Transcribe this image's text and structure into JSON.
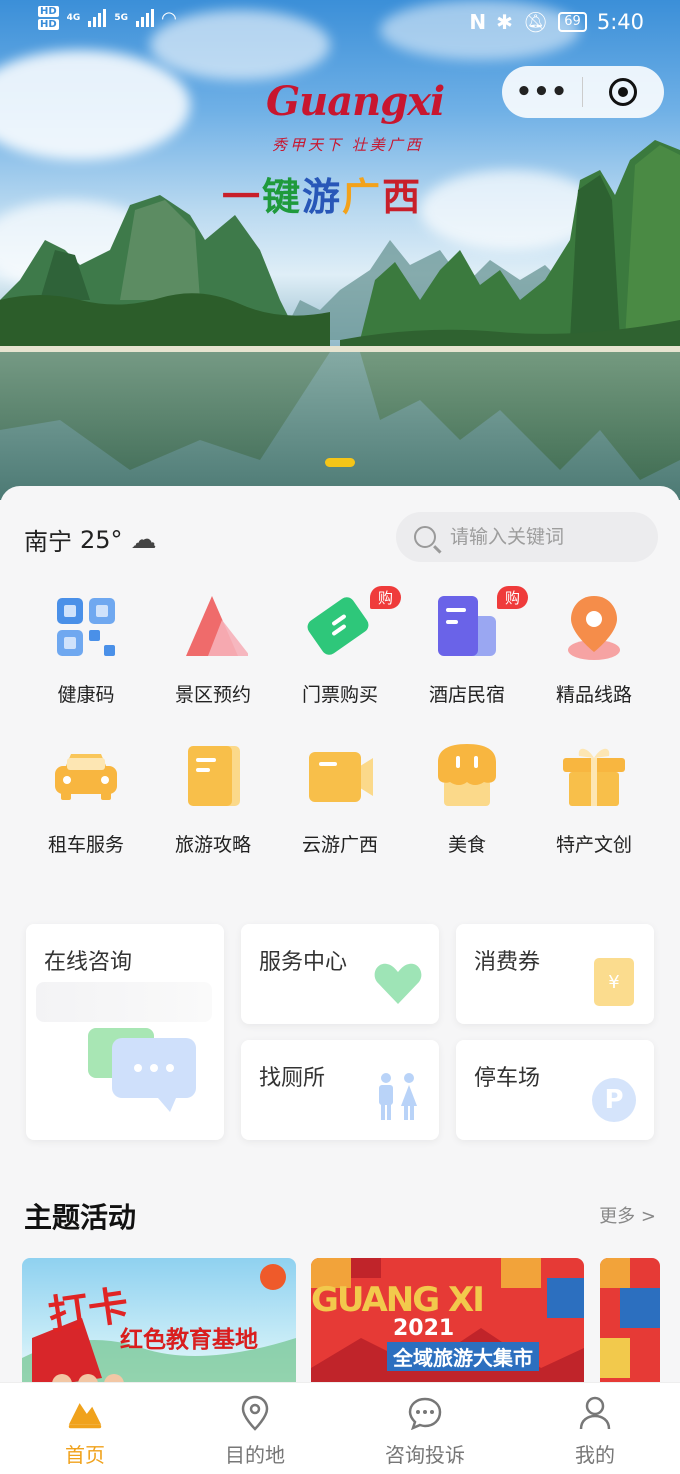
{
  "status_bar": {
    "left_tags": [
      "HD",
      "HD"
    ],
    "network_1": "4G",
    "network_2": "5G",
    "battery": "69",
    "time": "5:40"
  },
  "capsule": {
    "more_label": "•••",
    "close_icon": "target-icon"
  },
  "hero": {
    "logo_text": "Guangxi",
    "logo_tagline": "秀甲天下 壮美广西",
    "slogan_parts": [
      "一",
      "键",
      "游",
      "广",
      "西"
    ]
  },
  "weather": {
    "city": "南宁",
    "temperature": "25°",
    "icon": "partly-cloudy-icon"
  },
  "search": {
    "placeholder": "请输入关键词"
  },
  "services": [
    {
      "label": "健康码",
      "icon": "qr-code-icon"
    },
    {
      "label": "景区预约",
      "icon": "mountain-icon"
    },
    {
      "label": "门票购买",
      "icon": "ticket-icon",
      "badge": "购"
    },
    {
      "label": "酒店民宿",
      "icon": "hotel-icon",
      "badge": "购"
    },
    {
      "label": "精品线路",
      "icon": "location-pin-icon"
    },
    {
      "label": "租车服务",
      "icon": "car-icon"
    },
    {
      "label": "旅游攻略",
      "icon": "guide-book-icon"
    },
    {
      "label": "云游广西",
      "icon": "video-camera-icon"
    },
    {
      "label": "美食",
      "icon": "food-icon"
    },
    {
      "label": "特产文创",
      "icon": "gift-icon"
    }
  ],
  "quick_cards": {
    "online_consult": "在线咨询",
    "service_center": "服务中心",
    "coupon": "消费券",
    "toilet": "找厕所",
    "parking": "停车场",
    "coupon_symbol": "¥",
    "parking_symbol": "P"
  },
  "themes": {
    "title": "主题活动",
    "more": "更多 >",
    "banner1_big": "打卡",
    "banner1_sub": "红色教育基地",
    "banner2_word": "GUANG XI",
    "banner2_year": "2021",
    "banner2_sub": "全域旅游大集市"
  },
  "tabbar": [
    {
      "label": "首页",
      "icon": "home-icon",
      "active": true
    },
    {
      "label": "目的地",
      "icon": "location-icon",
      "active": false
    },
    {
      "label": "咨询投诉",
      "icon": "chat-icon",
      "active": false
    },
    {
      "label": "我的",
      "icon": "user-icon",
      "active": false
    }
  ],
  "colors": {
    "accent": "#f0a21c",
    "badge": "#ef3b3b"
  }
}
